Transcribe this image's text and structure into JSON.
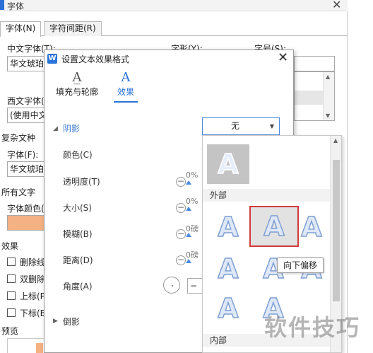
{
  "font_dialog": {
    "title": "字体",
    "tabs": [
      "字体(N)",
      "字符间距(R)"
    ],
    "chinese_font_label": "中文字体(T):",
    "chinese_font_value": "华文琥珀",
    "style_label": "字形(Y):",
    "size_label": "字号(S):",
    "western_font_label": "西文字体(",
    "western_font_value": "(使用中文",
    "complex_section": "复杂文种",
    "complex_font_label": "字体(F):",
    "complex_font_value": "华文琥珀",
    "all_text_section": "所有文字",
    "font_color_label": "字体颜色(",
    "font_color": "#f4b183",
    "effects_section": "效果",
    "effects": [
      "删除线",
      "双删除",
      "上标(P",
      "下标(B"
    ],
    "preview_label": "预览"
  },
  "effect_dialog": {
    "title": "设置文本效果格式",
    "tabs": [
      {
        "label": "填充与轮廓",
        "icon": "text-fill-icon"
      },
      {
        "label": "效果",
        "icon": "text-effect-icon"
      }
    ],
    "shadow_header": "阴影",
    "shadow_value": "无",
    "rows": [
      {
        "label": "颜色(C)",
        "value": ""
      },
      {
        "label": "透明度(T)",
        "value": "0%"
      },
      {
        "label": "大小(S)",
        "value": "0%"
      },
      {
        "label": "模糊(B)",
        "value": "0磅"
      },
      {
        "label": "距离(D)",
        "value": "0磅"
      },
      {
        "label": "角度(A)",
        "value": ""
      }
    ],
    "reflection_header": "倒影"
  },
  "shadow_popup": {
    "outer_label": "外部",
    "inner_label": "内部",
    "selected_preset": "向下偏移",
    "tooltip": "向下偏移",
    "preset_glyph": "A"
  },
  "watermark": "软件技巧"
}
